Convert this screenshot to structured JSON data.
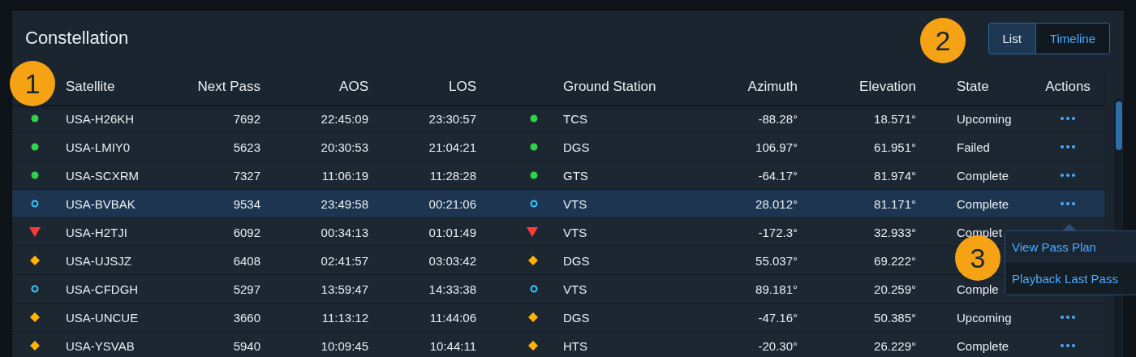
{
  "panel": {
    "title": "Constellation"
  },
  "view_toggle": [
    {
      "label": "List",
      "selected": true
    },
    {
      "label": "Timeline",
      "selected": false
    }
  ],
  "table": {
    "columns": [
      "Satellite",
      "Next Pass",
      "AOS",
      "LOS",
      "Ground Station",
      "Azimuth",
      "Elevation",
      "State",
      "Actions"
    ],
    "rows": [
      {
        "kind": "normal",
        "satellite": "USA-H26KH",
        "next_pass": "7692",
        "aos": "22:45:09",
        "los": "23:30:57",
        "ground_station": {
          "kind": "normal",
          "name": "TCS"
        },
        "azimuth": "-88.28°",
        "elevation": "18.571°",
        "state": "Upcoming",
        "selected": false
      },
      {
        "kind": "normal",
        "satellite": "USA-LMIY0",
        "next_pass": "5623",
        "aos": "20:30:53",
        "los": "21:04:21",
        "ground_station": {
          "kind": "normal",
          "name": "DGS"
        },
        "azimuth": "106.97°",
        "elevation": "61.951°",
        "state": "Failed",
        "selected": false
      },
      {
        "kind": "normal",
        "satellite": "USA-SCXRM",
        "next_pass": "7327",
        "aos": "11:06:19",
        "los": "11:28:28",
        "ground_station": {
          "kind": "normal",
          "name": "GTS"
        },
        "azimuth": "-64.17°",
        "elevation": "81.974°",
        "state": "Complete",
        "selected": false
      },
      {
        "kind": "standby",
        "satellite": "USA-BVBAK",
        "next_pass": "9534",
        "aos": "23:49:58",
        "los": "00:21:06",
        "ground_station": {
          "kind": "standby",
          "name": "VTS"
        },
        "azimuth": "28.012°",
        "elevation": "81.171°",
        "state": "Complete",
        "selected": true,
        "menu": [
          "View Pass Plan",
          "Playback Last Pass"
        ]
      },
      {
        "kind": "critical",
        "satellite": "USA-H2TJI",
        "next_pass": "6092",
        "aos": "00:34:13",
        "los": "01:01:49",
        "ground_station": {
          "kind": "critical",
          "name": "VTS"
        },
        "azimuth": "-172.3°",
        "elevation": "32.933°",
        "state": "Complet",
        "selected": false
      },
      {
        "kind": "serious",
        "satellite": "USA-UJSJZ",
        "next_pass": "6408",
        "aos": "02:41:57",
        "los": "03:03:42",
        "ground_station": {
          "kind": "serious",
          "name": "DGS"
        },
        "azimuth": "55.037°",
        "elevation": "69.222°",
        "selected": false
      },
      {
        "kind": "standby",
        "satellite": "USA-CFDGH",
        "next_pass": "5297",
        "aos": "13:59:47",
        "los": "14:33:38",
        "ground_station": {
          "kind": "standby",
          "name": "VTS"
        },
        "azimuth": "89.181°",
        "elevation": "20.259°",
        "state": "Comple",
        "selected": false
      },
      {
        "kind": "serious",
        "satellite": "USA-UNCUE",
        "next_pass": "3660",
        "aos": "11:13:12",
        "los": "11:44:06",
        "ground_station": {
          "kind": "serious",
          "name": "DGS"
        },
        "azimuth": "-47.16°",
        "elevation": "50.385°",
        "state": "Upcoming",
        "selected": false
      },
      {
        "kind": "serious",
        "satellite": "USA-YSVAB",
        "next_pass": "5940",
        "aos": "10:09:45",
        "los": "10:44:11",
        "ground_station": {
          "kind": "serious",
          "name": "HTS"
        },
        "azimuth": "-20.30°",
        "elevation": "26.229°",
        "state": "Complete",
        "selected": false
      }
    ]
  },
  "callouts": [
    "1",
    "2",
    "3"
  ]
}
